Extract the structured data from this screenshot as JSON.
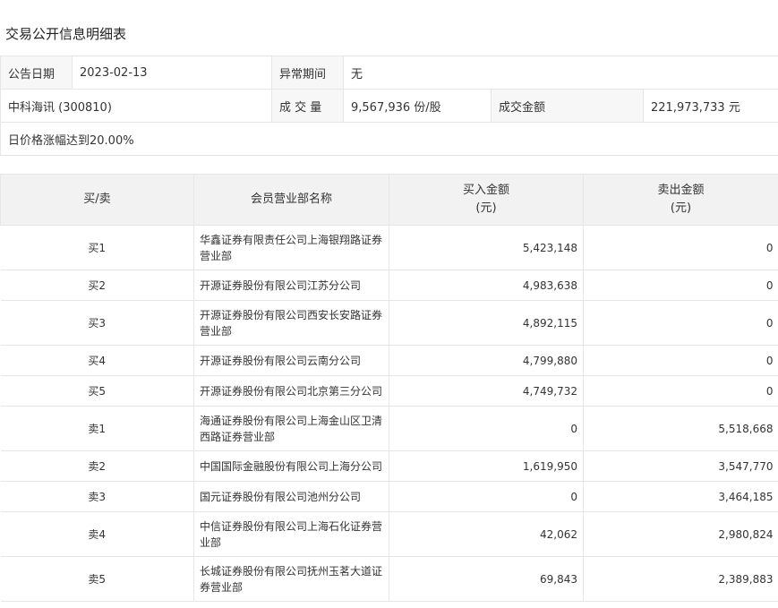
{
  "title": "交易公开信息明细表",
  "info": {
    "date_label": "公告日期",
    "date_value": "2023-02-13",
    "period_label": "异常期间",
    "period_value": "无",
    "stock": "中科海讯 (300810)",
    "volume_label": "成 交 量",
    "volume_value": "9,567,936 份/股",
    "amount_label": "成交金额",
    "amount_value": "221,973,733 元",
    "reason": "日价格涨幅达到20.00%"
  },
  "detail": {
    "headers": {
      "side": "买/卖",
      "branch": "会员营业部名称",
      "buy_line1": "买入金额",
      "buy_line2": "(元)",
      "sell_line1": "卖出金额",
      "sell_line2": "(元)"
    },
    "rows": [
      {
        "side": "买1",
        "branch": "华鑫证券有限责任公司上海银翔路证券营业部",
        "buy": "5,423,148",
        "sell": "0"
      },
      {
        "side": "买2",
        "branch": "开源证券股份有限公司江苏分公司",
        "buy": "4,983,638",
        "sell": "0"
      },
      {
        "side": "买3",
        "branch": "开源证券股份有限公司西安长安路证券营业部",
        "buy": "4,892,115",
        "sell": "0"
      },
      {
        "side": "买4",
        "branch": "开源证券股份有限公司云南分公司",
        "buy": "4,799,880",
        "sell": "0"
      },
      {
        "side": "买5",
        "branch": "开源证券股份有限公司北京第三分公司",
        "buy": "4,749,732",
        "sell": "0"
      },
      {
        "side": "卖1",
        "branch": "海通证券股份有限公司上海金山区卫清西路证券营业部",
        "buy": "0",
        "sell": "5,518,668"
      },
      {
        "side": "卖2",
        "branch": "中国国际金融股份有限公司上海分公司",
        "buy": "1,619,950",
        "sell": "3,547,770"
      },
      {
        "side": "卖3",
        "branch": "国元证券股份有限公司池州分公司",
        "buy": "0",
        "sell": "3,464,185"
      },
      {
        "side": "卖4",
        "branch": "中信证券股份有限公司上海石化证券营业部",
        "buy": "42,062",
        "sell": "2,980,824"
      },
      {
        "side": "卖5",
        "branch": "长城证券股份有限公司抚州玉茗大道证券营业部",
        "buy": "69,843",
        "sell": "2,389,883"
      }
    ]
  }
}
